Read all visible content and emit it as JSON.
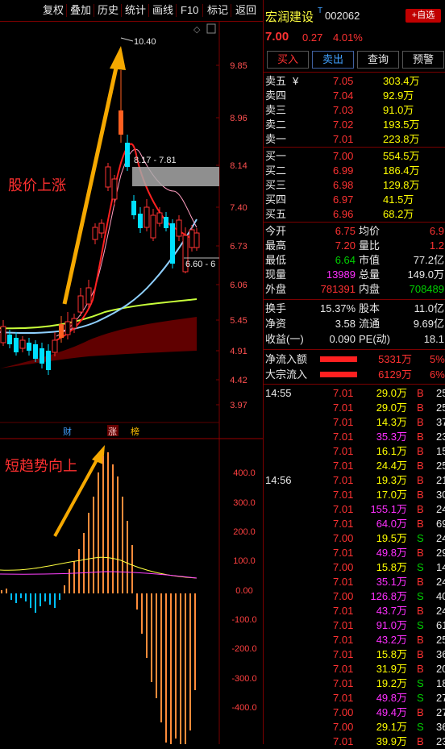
{
  "toolbar": {
    "buttons": [
      "复权",
      "叠加",
      "历史",
      "统计",
      "画线",
      "F10",
      "标记",
      "返回"
    ]
  },
  "stock": {
    "name": "宏润建设",
    "marker": "T",
    "code": "002062",
    "price": "7.00",
    "change": "0.27",
    "pct": "4.01%",
    "add_fav": "+自选"
  },
  "actions": [
    "买入",
    "卖出",
    "查询",
    "预警"
  ],
  "price_axis": [
    "9.85",
    "8.96",
    "8.14",
    "7.40",
    "6.73",
    "6.06",
    "5.45",
    "4.91",
    "4.42",
    "3.97"
  ],
  "macd_axis": [
    "400.0",
    "300.0",
    "200.0",
    "100.0",
    "0.00",
    "-100.0",
    "-200.0",
    "-300.0",
    "-400.0"
  ],
  "annotations": {
    "rise": "股价上涨",
    "trend": "短趋势向上",
    "high_label": "10.40",
    "range_label": "8.17 - 7.81",
    "low_label": "6.60 - 6",
    "badges": [
      "财",
      "涨",
      "榜"
    ]
  },
  "asks": [
    {
      "label": "卖五",
      "sym": "¥",
      "price": "7.05",
      "vol": "303.4万"
    },
    {
      "label": "卖四",
      "sym": "",
      "price": "7.04",
      "vol": "92.9万"
    },
    {
      "label": "卖三",
      "sym": "",
      "price": "7.03",
      "vol": "91.0万"
    },
    {
      "label": "卖二",
      "sym": "",
      "price": "7.02",
      "vol": "193.5万"
    },
    {
      "label": "卖一",
      "sym": "",
      "price": "7.01",
      "vol": "223.8万"
    }
  ],
  "bids": [
    {
      "label": "买一",
      "price": "7.00",
      "vol": "554.5万"
    },
    {
      "label": "买二",
      "price": "6.99",
      "vol": "186.4万"
    },
    {
      "label": "买三",
      "price": "6.98",
      "price_color": "red",
      "vol": "129.8万"
    },
    {
      "label": "买四",
      "price": "6.97",
      "vol": "41.5万"
    },
    {
      "label": "买五",
      "price": "6.96",
      "vol": "68.2万"
    }
  ],
  "stats": [
    {
      "l1": "今开",
      "v1": "6.75",
      "c1": "red",
      "l2": "均价",
      "v2": "6.9"
    },
    {
      "l1": "最高",
      "v1": "7.20",
      "c1": "red",
      "l2": "量比",
      "v2": "1.2"
    },
    {
      "l1": "最低",
      "v1": "6.64",
      "c1": "green",
      "l2": "市值",
      "v2": "77.2亿"
    },
    {
      "l1": "现量",
      "v1": "13989",
      "c1": "purple",
      "l2": "总量",
      "v2": "149.0万"
    },
    {
      "l1": "外盘",
      "v1": "781391",
      "c1": "red",
      "l2": "内盘",
      "v2": "708489"
    }
  ],
  "stats2": [
    {
      "l1": "换手",
      "v1": "15.37%",
      "l2": "股本",
      "v2": "11.0亿"
    },
    {
      "l1": "净资",
      "v1": "3.58",
      "l2": "流通",
      "v2": "9.69亿"
    },
    {
      "l1": "收益(一)",
      "v1": "0.090",
      "l2": "PE(动)",
      "v2": "18.1"
    }
  ],
  "flows": [
    {
      "label": "净流入额",
      "value": "5331万",
      "pct": "5%"
    },
    {
      "label": "大宗流入",
      "value": "6129万",
      "pct": "6%"
    }
  ],
  "ticks": [
    {
      "time": "14:55",
      "price": "7.01",
      "vol": "29.0万",
      "vc": "yellow",
      "side": "B",
      "n": "25"
    },
    {
      "time": "",
      "price": "7.01",
      "vol": "29.0万",
      "vc": "yellow",
      "side": "B",
      "n": "25"
    },
    {
      "time": "",
      "price": "7.01",
      "vol": "14.3万",
      "vc": "yellow",
      "side": "B",
      "n": "37"
    },
    {
      "time": "",
      "price": "7.01",
      "vol": "35.3万",
      "vc": "purple",
      "side": "B",
      "n": "23"
    },
    {
      "time": "",
      "price": "7.01",
      "vol": "16.1万",
      "vc": "yellow",
      "side": "B",
      "n": "15"
    },
    {
      "time": "",
      "price": "7.01",
      "vol": "24.4万",
      "vc": "yellow",
      "side": "B",
      "n": "25"
    },
    {
      "time": "14:56",
      "price": "7.01",
      "vol": "19.3万",
      "vc": "yellow",
      "side": "B",
      "n": "21"
    },
    {
      "time": "",
      "price": "7.01",
      "vol": "17.0万",
      "vc": "yellow",
      "side": "B",
      "n": "30"
    },
    {
      "time": "",
      "price": "7.01",
      "vol": "155.1万",
      "vc": "purple",
      "side": "B",
      "n": "24"
    },
    {
      "time": "",
      "price": "7.01",
      "vol": "64.0万",
      "vc": "purple",
      "side": "B",
      "n": "69"
    },
    {
      "time": "",
      "price": "7.00",
      "vol": "19.5万",
      "vc": "yellow",
      "side": "S",
      "n": "24"
    },
    {
      "time": "",
      "price": "7.01",
      "vol": "49.8万",
      "vc": "purple",
      "side": "B",
      "n": "29"
    },
    {
      "time": "",
      "price": "7.00",
      "vol": "15.8万",
      "vc": "yellow",
      "side": "S",
      "n": "14"
    },
    {
      "time": "",
      "price": "7.01",
      "vol": "35.1万",
      "vc": "purple",
      "side": "B",
      "n": "24"
    },
    {
      "time": "",
      "price": "7.00",
      "vol": "126.8万",
      "vc": "purple",
      "side": "S",
      "n": "40"
    },
    {
      "time": "",
      "price": "7.01",
      "vol": "43.7万",
      "vc": "purple",
      "side": "B",
      "n": "24"
    },
    {
      "time": "",
      "price": "7.01",
      "vol": "91.0万",
      "vc": "purple",
      "side": "S",
      "n": "61"
    },
    {
      "time": "",
      "price": "7.01",
      "vol": "43.2万",
      "vc": "purple",
      "side": "B",
      "n": "25"
    },
    {
      "time": "",
      "price": "7.01",
      "vol": "15.8万",
      "vc": "yellow",
      "side": "B",
      "n": "36"
    },
    {
      "time": "",
      "price": "7.01",
      "vol": "31.9万",
      "vc": "yellow",
      "side": "B",
      "n": "20"
    },
    {
      "time": "",
      "price": "7.01",
      "vol": "19.2万",
      "vc": "yellow",
      "side": "S",
      "n": "18"
    },
    {
      "time": "",
      "price": "7.01",
      "vol": "49.8万",
      "vc": "purple",
      "side": "S",
      "n": "27"
    },
    {
      "time": "",
      "price": "7.00",
      "vol": "49.4万",
      "vc": "purple",
      "side": "B",
      "n": "27"
    },
    {
      "time": "",
      "price": "7.00",
      "vol": "29.1万",
      "vc": "yellow",
      "side": "S",
      "n": "36"
    },
    {
      "time": "",
      "price": "7.01",
      "vol": "39.9万",
      "vc": "yellow",
      "side": "B",
      "n": "23"
    }
  ],
  "colors": {
    "up": "#ff3232",
    "down": "#00e0ff",
    "bg": "#000000",
    "grid": "#7a0000",
    "arrow": "#f5a800"
  }
}
